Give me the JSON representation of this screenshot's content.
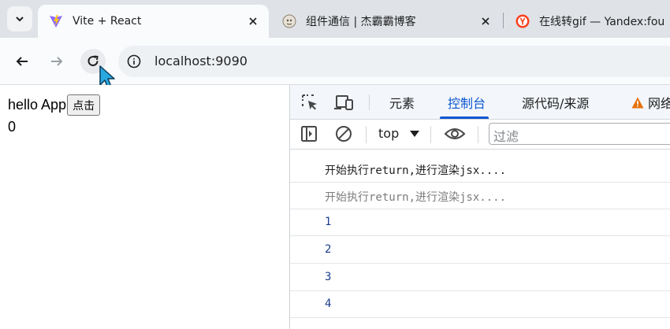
{
  "browser": {
    "tabs": [
      {
        "title": "Vite + React",
        "active": true,
        "favicon": "vite-icon"
      },
      {
        "title": "组件通信 | 杰霸霸博客",
        "active": false,
        "favicon": "blog-icon"
      },
      {
        "title": "在线转gif — Yandex:fou",
        "active": false,
        "favicon": "yandex-icon"
      }
    ],
    "url": "localhost:9090"
  },
  "page": {
    "hello_text": "hello App",
    "button_label": "点击",
    "count": "0"
  },
  "devtools": {
    "tabs": [
      {
        "label": "元素",
        "active": false
      },
      {
        "label": "控制台",
        "active": true
      },
      {
        "label": "源代码/来源",
        "active": false
      },
      {
        "label": "网络",
        "active": false
      }
    ],
    "context": "top",
    "filter_placeholder": "过滤",
    "logs": [
      {
        "text": "开始执行return,进行渲染jsx....",
        "style": "first"
      },
      {
        "text": "开始执行return,进行渲染jsx....",
        "style": "grey"
      },
      {
        "text": "1",
        "style": "num"
      },
      {
        "text": "2",
        "style": "num"
      },
      {
        "text": "3",
        "style": "num"
      },
      {
        "text": "4",
        "style": "num"
      }
    ]
  },
  "colors": {
    "accent": "#0b57d0",
    "tabstrip": "#dfe3e7",
    "warning": "#e8710a"
  }
}
